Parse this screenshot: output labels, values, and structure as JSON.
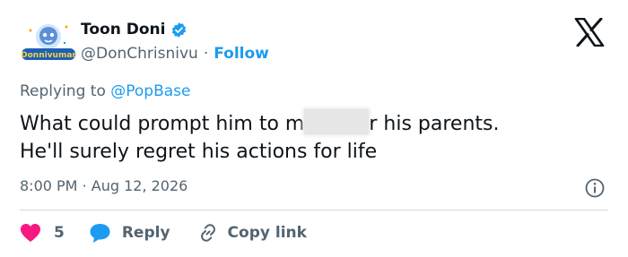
{
  "account": {
    "display_name": "Toon Doni",
    "handle": "@DonChrisnivu",
    "follow_label": "Follow",
    "separator": "·",
    "avatar_text": "Donnivumar",
    "verified_color": "#1d9bf0"
  },
  "tweet": {
    "replying_prefix": "Replying to",
    "replying_to": "@PopBase",
    "text_part1": "What could prompt him to m",
    "text_part2": "r his parents.",
    "text_line2": "He'll surely regret his actions for life",
    "time": "8:00 PM",
    "date": "Aug 12, 2026"
  },
  "actions": {
    "like_count": "5",
    "reply_label": "Reply",
    "copy_link_label": "Copy link"
  },
  "colors": {
    "accent": "#1d9bf0",
    "like": "#f91880",
    "secondary_text": "#536471",
    "primary_text": "#0f1419"
  },
  "icons": [
    "heart-icon",
    "reply-bubble-icon",
    "link-icon",
    "info-icon",
    "x-logo-icon",
    "verified-badge-icon"
  ]
}
